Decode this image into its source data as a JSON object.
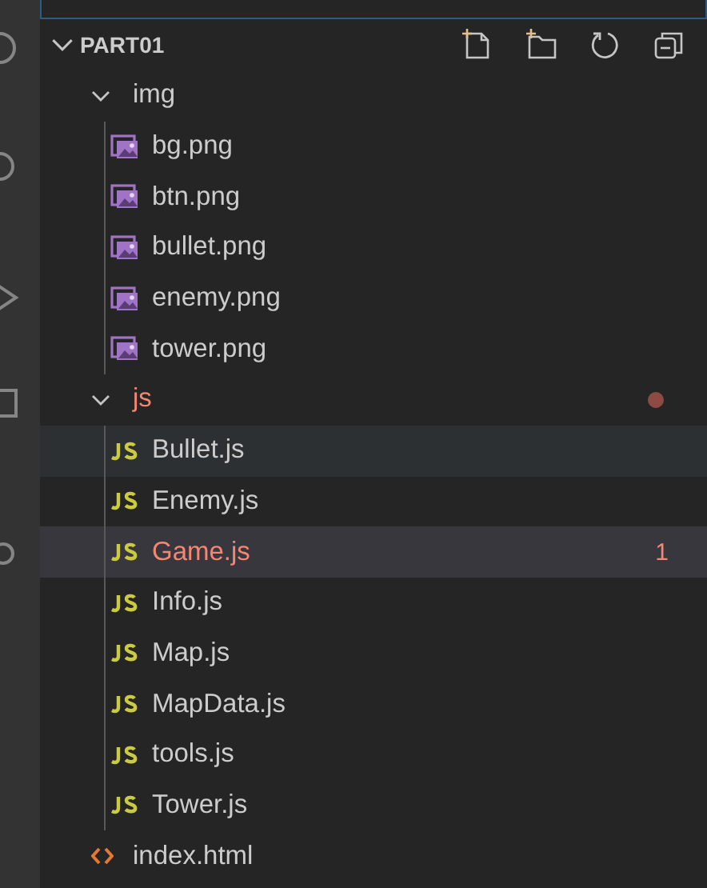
{
  "explorer": {
    "root": {
      "label": "PART01",
      "expanded": true
    },
    "tree": [
      {
        "kind": "folder",
        "label": "img",
        "expanded": true,
        "error": false,
        "selected": false,
        "hovered": false,
        "children": [
          {
            "kind": "image",
            "label": "bg.png",
            "error": false,
            "selected": false,
            "hovered": false
          },
          {
            "kind": "image",
            "label": "btn.png",
            "error": false,
            "selected": false,
            "hovered": false
          },
          {
            "kind": "image",
            "label": "bullet.png",
            "error": false,
            "selected": false,
            "hovered": false
          },
          {
            "kind": "image",
            "label": "enemy.png",
            "error": false,
            "selected": false,
            "hovered": false
          },
          {
            "kind": "image",
            "label": "tower.png",
            "error": false,
            "selected": false,
            "hovered": false
          }
        ]
      },
      {
        "kind": "folder",
        "label": "js",
        "expanded": true,
        "error": true,
        "selected": false,
        "hovered": false,
        "children": [
          {
            "kind": "js",
            "label": "Bullet.js",
            "error": false,
            "selected": false,
            "hovered": true
          },
          {
            "kind": "js",
            "label": "Enemy.js",
            "error": false,
            "selected": false,
            "hovered": false
          },
          {
            "kind": "js",
            "label": "Game.js",
            "error": true,
            "badge": "1",
            "selected": true,
            "hovered": false
          },
          {
            "kind": "js",
            "label": "Info.js",
            "error": false,
            "selected": false,
            "hovered": false
          },
          {
            "kind": "js",
            "label": "Map.js",
            "error": false,
            "selected": false,
            "hovered": false
          },
          {
            "kind": "js",
            "label": "MapData.js",
            "error": false,
            "selected": false,
            "hovered": false
          },
          {
            "kind": "js",
            "label": "tools.js",
            "error": false,
            "selected": false,
            "hovered": false
          },
          {
            "kind": "js",
            "label": "Tower.js",
            "error": false,
            "selected": false,
            "hovered": false
          }
        ]
      },
      {
        "kind": "html",
        "label": "index.html",
        "error": false,
        "selected": false,
        "hovered": false
      }
    ]
  }
}
